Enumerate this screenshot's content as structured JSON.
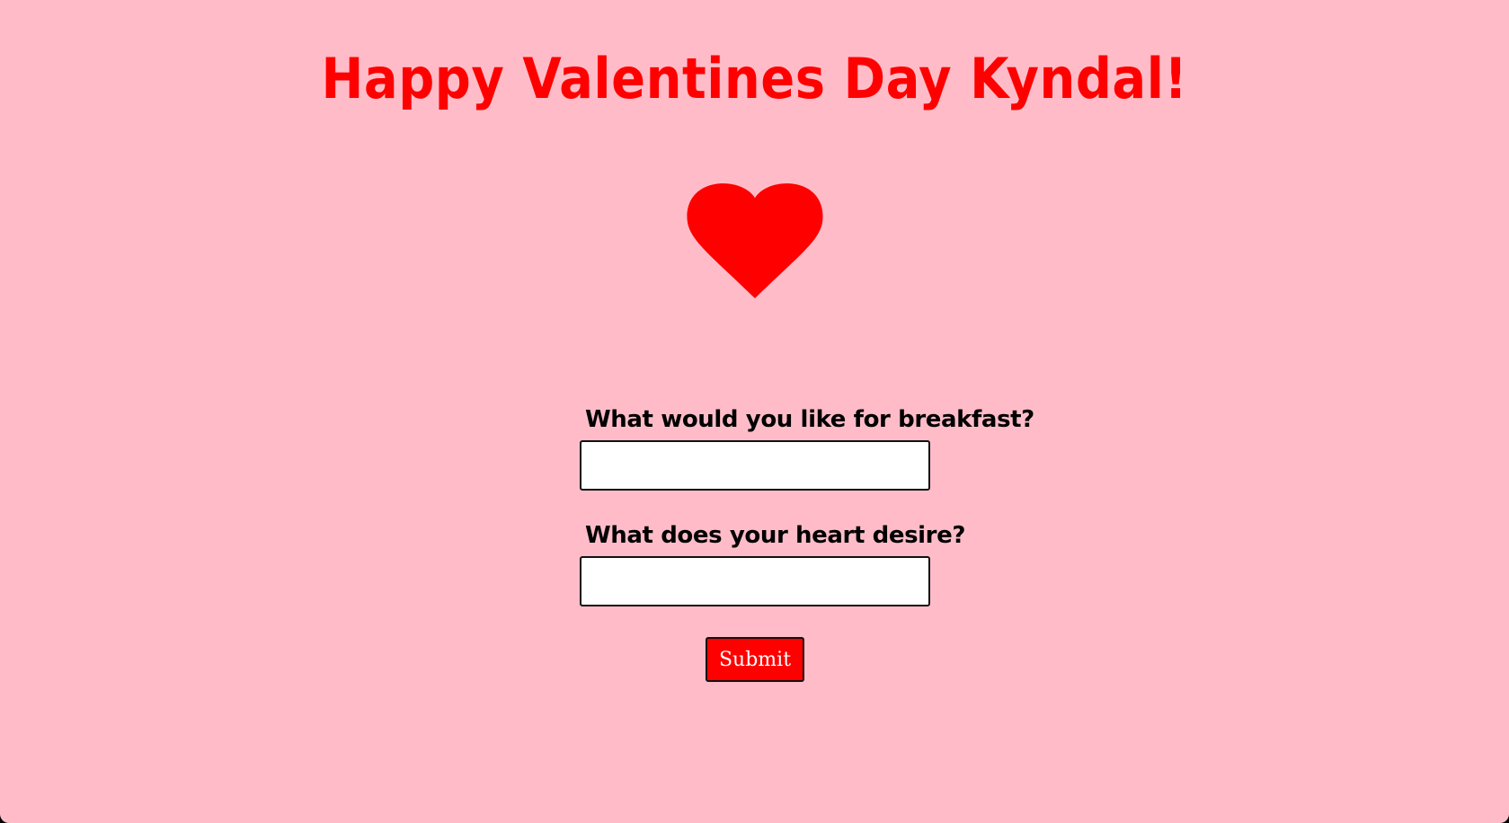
{
  "header": {
    "title": "Happy Valentines Day Kyndal!"
  },
  "decoration": {
    "icon": "heart-icon",
    "color": "#ff0000"
  },
  "form": {
    "question_1": "What would you like for breakfast?",
    "answer_1": "",
    "question_2": "What does your heart desire?",
    "answer_2": "",
    "submit_label": "Submit"
  },
  "colors": {
    "background": "#ffbcc8",
    "accent": "#ff0000",
    "text": "#000000"
  }
}
